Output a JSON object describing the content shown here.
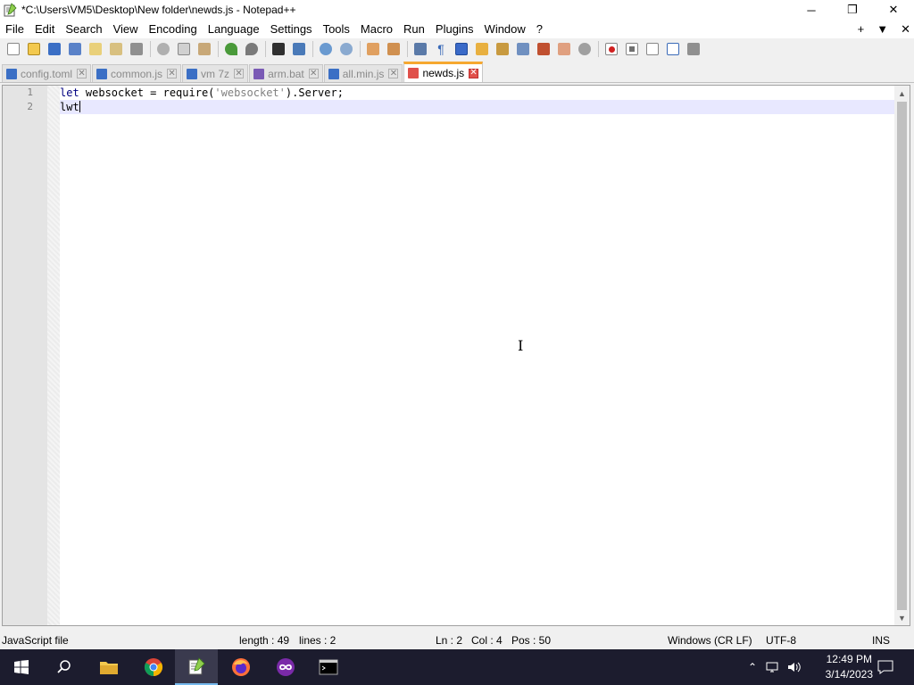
{
  "window": {
    "title": "*C:\\Users\\VM5\\Desktop\\New folder\\newds.js - Notepad++",
    "minimize": "─",
    "restore": "❐",
    "close": "✕"
  },
  "menu": {
    "items": [
      "File",
      "Edit",
      "Search",
      "View",
      "Encoding",
      "Language",
      "Settings",
      "Tools",
      "Macro",
      "Run",
      "Plugins",
      "Window",
      "?"
    ],
    "right_plus": "+",
    "right_down": "▼",
    "right_close": "✕"
  },
  "toolbar": {
    "icons": [
      "new-file-icon",
      "open-file-icon",
      "save-icon",
      "save-all-icon",
      "close-icon",
      "close-all-icon",
      "print-icon",
      "cut-icon",
      "copy-icon",
      "paste-icon",
      "undo-icon",
      "redo-icon",
      "find-icon",
      "replace-icon",
      "zoom-in-icon",
      "zoom-out-icon",
      "sync-v-icon",
      "sync-h-icon",
      "word-wrap-icon",
      "show-all-chars-icon",
      "indent-guide-icon",
      "udl-icon",
      "doc-map-icon",
      "doc-list-icon",
      "function-list-icon",
      "folder-workspace-icon",
      "monitoring-icon",
      "record-macro-icon",
      "stop-record-icon",
      "play-macro-icon",
      "run-multiple-icon",
      "save-macro-icon"
    ]
  },
  "tabs": [
    {
      "label": "config.toml",
      "active": false
    },
    {
      "label": "common.js",
      "active": false
    },
    {
      "label": "vm 7z",
      "active": false
    },
    {
      "label": "arm.bat",
      "active": false
    },
    {
      "label": "all.min.js",
      "active": false
    },
    {
      "label": "newds.js",
      "active": true
    }
  ],
  "editor": {
    "line_numbers": [
      "1",
      "2"
    ],
    "line1": {
      "kw_let": "let",
      "t1": " websocket = require(",
      "str": "'websocket'",
      "t2": ").Server;"
    },
    "line2": "lwt"
  },
  "status": {
    "file_type": "JavaScript file",
    "length": "length : 49",
    "lines": "lines : 2",
    "ln": "Ln : 2",
    "col": "Col : 4",
    "pos": "Pos : 50",
    "eol": "Windows (CR LF)",
    "encoding": "UTF-8",
    "mode": "INS"
  },
  "taskbar": {
    "time": "12:49 PM",
    "date": "3/14/2023"
  },
  "colors": {
    "accent_tab": "#f6a830",
    "current_line": "#e8e8ff",
    "keyword": "#000080",
    "string": "#808080"
  }
}
